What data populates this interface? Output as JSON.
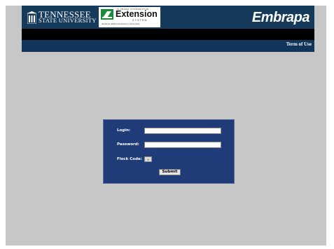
{
  "header": {
    "tsu": {
      "line1": "TENNESSEE",
      "line2": "STATE UNIVERSITY",
      "icon": "tsu-seal-icon"
    },
    "extension": {
      "small_caps": "ALABAMA COOPERATIVE",
      "title": "Extension",
      "system": "SYSTEM",
      "subtitle": "Alabama A&M and Auburn Universities",
      "icon": "extension-logo-icon"
    },
    "embrapa": "Embrapa"
  },
  "nav": {
    "term_of_use": "Term of Use"
  },
  "login_form": {
    "login_label": "Login:",
    "login_value": "",
    "password_label": "Password:",
    "password_value": "",
    "flock_label": "Flock Code:",
    "flock_value": "",
    "submit_label": "Submit"
  },
  "colors": {
    "header_bg": "#153a5c",
    "form_bg": "#1f3b78",
    "page_bg": "#c7c7c7"
  }
}
